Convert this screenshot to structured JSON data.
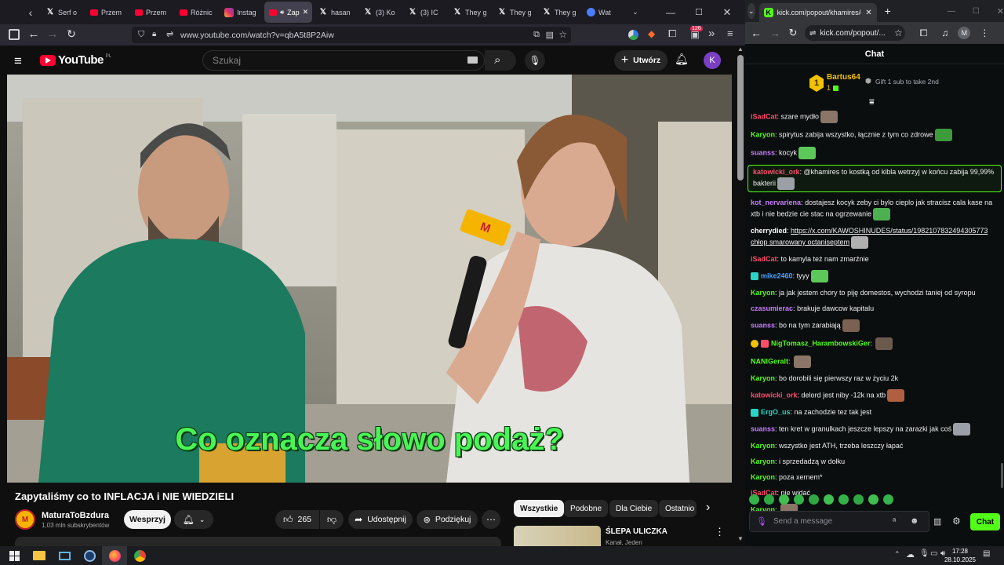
{
  "firefox": {
    "tabs": [
      {
        "label": "Serf o",
        "icon": "x-logo-icon",
        "color": "#ffffff"
      },
      {
        "label": "Przem",
        "icon": "youtube-icon",
        "color": "#ff0033"
      },
      {
        "label": "Przem",
        "icon": "youtube-icon",
        "color": "#ff0033"
      },
      {
        "label": "Różnic",
        "icon": "youtube-icon",
        "color": "#ff0033"
      },
      {
        "label": "Instag",
        "icon": "instagram-icon",
        "color": "#e1306c"
      },
      {
        "label": "Zap",
        "icon": "youtube-icon",
        "color": "#ff0033",
        "active": true
      },
      {
        "label": "hasan",
        "icon": "x-logo-icon",
        "color": "#ffffff"
      },
      {
        "label": "(3) Ko",
        "icon": "x-logo-icon",
        "color": "#ffffff"
      },
      {
        "label": "(3) IC",
        "icon": "x-logo-icon",
        "color": "#ffffff"
      },
      {
        "label": "They g",
        "icon": "x-logo-icon",
        "color": "#ffffff"
      },
      {
        "label": "They g",
        "icon": "x-logo-icon",
        "color": "#ffffff"
      },
      {
        "label": "They g",
        "icon": "x-logo-icon",
        "color": "#ffffff"
      },
      {
        "label": "Wat",
        "icon": "watch-party-icon",
        "color": "#4a7cff"
      }
    ],
    "url": "www.youtube.com/watch?v=qbA5t8P2Aiw",
    "ext_badge": "126"
  },
  "youtube": {
    "logo": "YouTube",
    "region": "PL",
    "search_placeholder": "Szukaj",
    "create_label": "Utwórz",
    "avatar_letter": "K",
    "subtitle": "Co oznacza słowo podaż?",
    "mic_badge": "M",
    "title": "Zapytaliśmy co to INFLACJA i NIE WIEDZIELI",
    "channel": {
      "name": "MaturaToBzdura",
      "subs": "1,03 mln subskrybentów",
      "avatar_letter": "M"
    },
    "support_label": "Wesprzyj",
    "likes": "265",
    "share_label": "Udostępnij",
    "thanks_label": "Podziękuj",
    "chips": [
      "Wszystkie",
      "Podobne",
      "Dla Ciebie",
      "Ostatnio"
    ],
    "rec": {
      "title": "ŚLEPA ULICZKA",
      "channel": "Kanał, Jeden"
    }
  },
  "chrome": {
    "tab_title": "kick.com/popout/khamires/cha",
    "url": "kick.com/popout/...",
    "profile_letter": "M"
  },
  "kick": {
    "header": "Chat",
    "accent": "#53fc18",
    "pinned": {
      "rank": "1",
      "user": "Bartus64",
      "count": "1",
      "gift_text": "Gift 1 sub to take 2nd"
    },
    "messages": [
      {
        "user": "iSadCat",
        "color": "#ff4d6a",
        "text": "szare mydło",
        "emote": "#8a7566"
      },
      {
        "user": "Karyon",
        "color": "#53fc18",
        "text": "spirytus zabija wszystko, łącznie z tym co zdrowe",
        "emote": "#3e9b3c"
      },
      {
        "user": "suanss",
        "color": "#c77dff",
        "text": "kocyk",
        "emote": "#5cc85a"
      },
      {
        "user": "katowicki_ork",
        "color": "#ff4d6a",
        "text": "@khamires to kostką od kibla wetrzyj w końcu zabija 99,99% bakterii",
        "emote": "#9aa0a6",
        "highlight": true
      },
      {
        "user": "kot_nervariena",
        "color": "#c77dff",
        "text": "dostajesz kocyk zeby ci bylo cieplo jak stracisz cala kase na xtb i nie bedzie cie stac na ogrzewanie",
        "emote": "#4caf50"
      },
      {
        "user": "cherrydied",
        "color": "#ffffff",
        "text": "https://x.com/KAWOSHINUDES/status/1982107832494305773 chłop smarowany octaniseptem",
        "emote": "#b0b0b0"
      },
      {
        "user": "iSadCat",
        "color": "#ff4d6a",
        "text": "to kamyla też nam zmarźnie"
      },
      {
        "user": "mike2460",
        "color": "#4aa3ff",
        "text": "tyyy",
        "emote": "#5cc85a",
        "badge": "#2ad4c4"
      },
      {
        "user": "Karyon",
        "color": "#53fc18",
        "text": "ja jak jestem chory to piję domestos, wychodzi taniej od syropu"
      },
      {
        "user": "czasumierac",
        "color": "#c77dff",
        "text": "brakuje dawcow kapitalu"
      },
      {
        "user": "suanss",
        "color": "#c77dff",
        "text": "bo na tym zarabiają",
        "emote": "#7a6152"
      },
      {
        "user": "NigTomasz_HarambowskiGer",
        "color": "#53fc18",
        "text": "",
        "emote": "#6b5a4e",
        "badge": "#f2c200",
        "badge2": "#ff4d6a"
      },
      {
        "user": "NANIGeralt",
        "color": "#53fc18",
        "text": "",
        "emote": "#8a7566"
      },
      {
        "user": "Karyon",
        "color": "#53fc18",
        "text": "bo dorobili się pierwszy raz w życiu 2k"
      },
      {
        "user": "katowicki_ork",
        "color": "#ff4d6a",
        "text": "delord jest niby -12k na xtb",
        "emote": "#b06040"
      },
      {
        "user": "ErgO_us",
        "color": "#2ad4c4",
        "text": "na zachodzie tez tak jest",
        "badge": "#2ad4c4"
      },
      {
        "user": "suanss",
        "color": "#c77dff",
        "text": "ten kret w granulkach jeszcze lepszy na zarazki jak coś",
        "emote": "#9aa0a6"
      },
      {
        "user": "Karyon",
        "color": "#53fc18",
        "text": "wszystko jest ATH, trzeba leszczy łapać"
      },
      {
        "user": "Karyon",
        "color": "#53fc18",
        "text": "i sprzedadzą w dołku"
      },
      {
        "user": "Karyon",
        "color": "#53fc18",
        "text": "poza xernem*"
      },
      {
        "user": "iSadCat",
        "color": "#ff4d6a",
        "text": "nie widać"
      },
      {
        "user": "Karyon",
        "color": "#53fc18",
        "text": "",
        "emote": "#8a7566"
      }
    ],
    "input_placeholder": "Send a message",
    "chat_button": "Chat"
  },
  "taskbar": {
    "time": "17:28",
    "date": "28.10.2025"
  }
}
